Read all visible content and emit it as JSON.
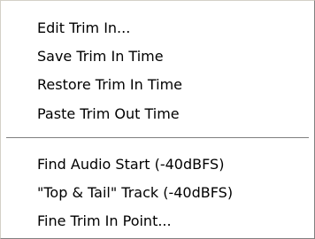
{
  "menu": {
    "group1": [
      {
        "label": "Edit Trim In..."
      },
      {
        "label": "Save Trim In Time"
      },
      {
        "label": "Restore Trim In Time"
      },
      {
        "label": "Paste Trim Out Time"
      }
    ],
    "group2": [
      {
        "label": "Find Audio Start (-40dBFS)"
      },
      {
        "label": "\"Top & Tail\" Track (-40dBFS)"
      },
      {
        "label": "Fine Trim In Point..."
      }
    ]
  }
}
